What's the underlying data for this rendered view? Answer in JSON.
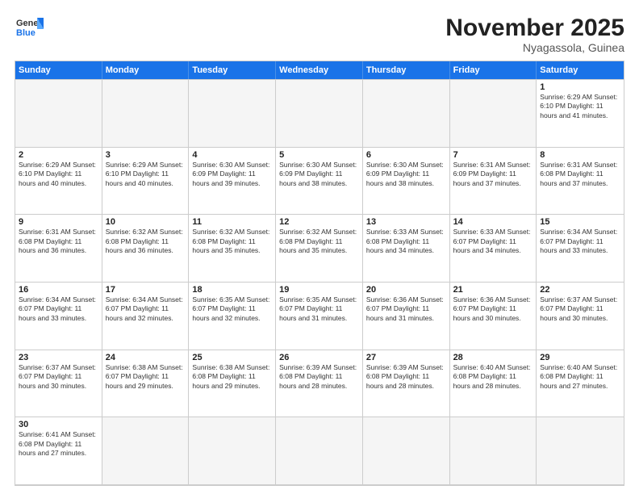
{
  "logo": {
    "line1": "General",
    "line2": "Blue"
  },
  "title": "November 2025",
  "location": "Nyagassola, Guinea",
  "headers": [
    "Sunday",
    "Monday",
    "Tuesday",
    "Wednesday",
    "Thursday",
    "Friday",
    "Saturday"
  ],
  "cells": [
    {
      "num": "",
      "info": "",
      "empty": true
    },
    {
      "num": "",
      "info": "",
      "empty": true
    },
    {
      "num": "",
      "info": "",
      "empty": true
    },
    {
      "num": "",
      "info": "",
      "empty": true
    },
    {
      "num": "",
      "info": "",
      "empty": true
    },
    {
      "num": "",
      "info": "",
      "empty": true
    },
    {
      "num": "1",
      "info": "Sunrise: 6:29 AM\nSunset: 6:10 PM\nDaylight: 11 hours\nand 41 minutes."
    },
    {
      "num": "2",
      "info": "Sunrise: 6:29 AM\nSunset: 6:10 PM\nDaylight: 11 hours\nand 40 minutes."
    },
    {
      "num": "3",
      "info": "Sunrise: 6:29 AM\nSunset: 6:10 PM\nDaylight: 11 hours\nand 40 minutes."
    },
    {
      "num": "4",
      "info": "Sunrise: 6:30 AM\nSunset: 6:09 PM\nDaylight: 11 hours\nand 39 minutes."
    },
    {
      "num": "5",
      "info": "Sunrise: 6:30 AM\nSunset: 6:09 PM\nDaylight: 11 hours\nand 38 minutes."
    },
    {
      "num": "6",
      "info": "Sunrise: 6:30 AM\nSunset: 6:09 PM\nDaylight: 11 hours\nand 38 minutes."
    },
    {
      "num": "7",
      "info": "Sunrise: 6:31 AM\nSunset: 6:09 PM\nDaylight: 11 hours\nand 37 minutes."
    },
    {
      "num": "8",
      "info": "Sunrise: 6:31 AM\nSunset: 6:08 PM\nDaylight: 11 hours\nand 37 minutes."
    },
    {
      "num": "9",
      "info": "Sunrise: 6:31 AM\nSunset: 6:08 PM\nDaylight: 11 hours\nand 36 minutes."
    },
    {
      "num": "10",
      "info": "Sunrise: 6:32 AM\nSunset: 6:08 PM\nDaylight: 11 hours\nand 36 minutes."
    },
    {
      "num": "11",
      "info": "Sunrise: 6:32 AM\nSunset: 6:08 PM\nDaylight: 11 hours\nand 35 minutes."
    },
    {
      "num": "12",
      "info": "Sunrise: 6:32 AM\nSunset: 6:08 PM\nDaylight: 11 hours\nand 35 minutes."
    },
    {
      "num": "13",
      "info": "Sunrise: 6:33 AM\nSunset: 6:08 PM\nDaylight: 11 hours\nand 34 minutes."
    },
    {
      "num": "14",
      "info": "Sunrise: 6:33 AM\nSunset: 6:07 PM\nDaylight: 11 hours\nand 34 minutes."
    },
    {
      "num": "15",
      "info": "Sunrise: 6:34 AM\nSunset: 6:07 PM\nDaylight: 11 hours\nand 33 minutes."
    },
    {
      "num": "16",
      "info": "Sunrise: 6:34 AM\nSunset: 6:07 PM\nDaylight: 11 hours\nand 33 minutes."
    },
    {
      "num": "17",
      "info": "Sunrise: 6:34 AM\nSunset: 6:07 PM\nDaylight: 11 hours\nand 32 minutes."
    },
    {
      "num": "18",
      "info": "Sunrise: 6:35 AM\nSunset: 6:07 PM\nDaylight: 11 hours\nand 32 minutes."
    },
    {
      "num": "19",
      "info": "Sunrise: 6:35 AM\nSunset: 6:07 PM\nDaylight: 11 hours\nand 31 minutes."
    },
    {
      "num": "20",
      "info": "Sunrise: 6:36 AM\nSunset: 6:07 PM\nDaylight: 11 hours\nand 31 minutes."
    },
    {
      "num": "21",
      "info": "Sunrise: 6:36 AM\nSunset: 6:07 PM\nDaylight: 11 hours\nand 30 minutes."
    },
    {
      "num": "22",
      "info": "Sunrise: 6:37 AM\nSunset: 6:07 PM\nDaylight: 11 hours\nand 30 minutes."
    },
    {
      "num": "23",
      "info": "Sunrise: 6:37 AM\nSunset: 6:07 PM\nDaylight: 11 hours\nand 30 minutes."
    },
    {
      "num": "24",
      "info": "Sunrise: 6:38 AM\nSunset: 6:07 PM\nDaylight: 11 hours\nand 29 minutes."
    },
    {
      "num": "25",
      "info": "Sunrise: 6:38 AM\nSunset: 6:08 PM\nDaylight: 11 hours\nand 29 minutes."
    },
    {
      "num": "26",
      "info": "Sunrise: 6:39 AM\nSunset: 6:08 PM\nDaylight: 11 hours\nand 28 minutes."
    },
    {
      "num": "27",
      "info": "Sunrise: 6:39 AM\nSunset: 6:08 PM\nDaylight: 11 hours\nand 28 minutes."
    },
    {
      "num": "28",
      "info": "Sunrise: 6:40 AM\nSunset: 6:08 PM\nDaylight: 11 hours\nand 28 minutes."
    },
    {
      "num": "29",
      "info": "Sunrise: 6:40 AM\nSunset: 6:08 PM\nDaylight: 11 hours\nand 27 minutes."
    },
    {
      "num": "30",
      "info": "Sunrise: 6:41 AM\nSunset: 6:08 PM\nDaylight: 11 hours\nand 27 minutes."
    },
    {
      "num": "",
      "info": "",
      "empty": true
    },
    {
      "num": "",
      "info": "",
      "empty": true
    },
    {
      "num": "",
      "info": "",
      "empty": true
    },
    {
      "num": "",
      "info": "",
      "empty": true
    },
    {
      "num": "",
      "info": "",
      "empty": true
    },
    {
      "num": "",
      "info": "",
      "empty": true
    }
  ]
}
